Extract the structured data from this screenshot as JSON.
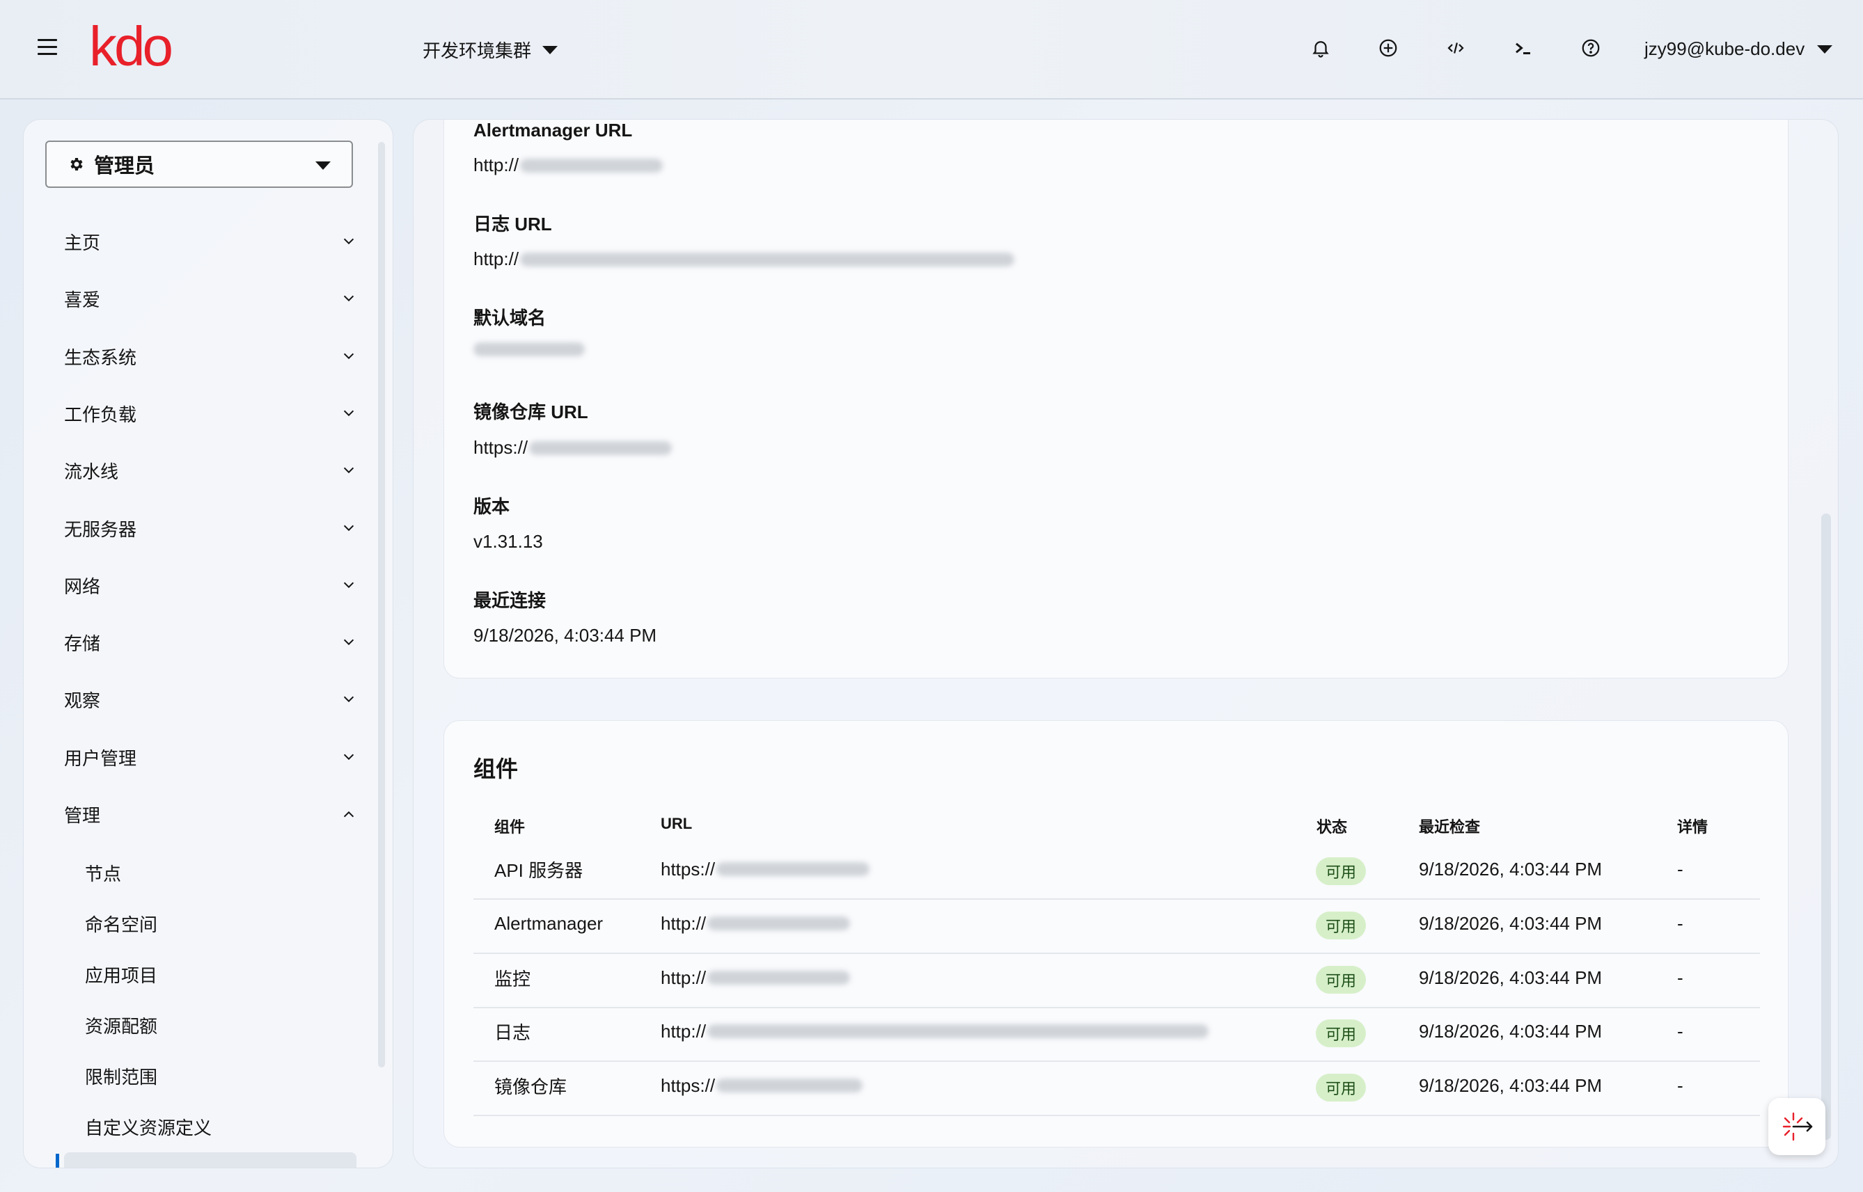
{
  "header": {
    "logo": "kdo",
    "cluster": "开发环境集群",
    "user": "jzy99@kube-do.dev"
  },
  "sidebar": {
    "role": "管理员",
    "items": [
      {
        "label": "主页",
        "expanded": false
      },
      {
        "label": "喜爱",
        "expanded": false
      },
      {
        "label": "生态系统",
        "expanded": false
      },
      {
        "label": "工作负载",
        "expanded": false
      },
      {
        "label": "流水线",
        "expanded": false
      },
      {
        "label": "无服务器",
        "expanded": false
      },
      {
        "label": "网络",
        "expanded": false
      },
      {
        "label": "存储",
        "expanded": false
      },
      {
        "label": "观察",
        "expanded": false
      },
      {
        "label": "用户管理",
        "expanded": false
      },
      {
        "label": "管理",
        "expanded": true
      }
    ],
    "sub_items": [
      "节点",
      "命名空间",
      "应用项目",
      "资源配额",
      "限制范围",
      "自定义资源定义"
    ]
  },
  "details": {
    "alertmanager_url": {
      "label": "Alertmanager URL",
      "value": "http://"
    },
    "logging_url": {
      "label": "日志 URL",
      "value": "http://"
    },
    "default_domain": {
      "label": "默认域名",
      "value": ""
    },
    "registry_url": {
      "label": "镜像仓库 URL",
      "value": "https://"
    },
    "version": {
      "label": "版本",
      "value": "v1.31.13"
    },
    "last_connected": {
      "label": "最近连接",
      "value": "9/18/2026, 4:03:44 PM"
    }
  },
  "components": {
    "title": "组件",
    "columns": [
      "组件",
      "URL",
      "状态",
      "最近检查",
      "详情"
    ],
    "rows": [
      {
        "name": "API 服务器",
        "url": "https://",
        "status": "可用",
        "checked": "9/18/2026, 4:03:44 PM",
        "detail": "-"
      },
      {
        "name": "Alertmanager",
        "url": "http://",
        "status": "可用",
        "checked": "9/18/2026, 4:03:44 PM",
        "detail": "-"
      },
      {
        "name": "监控",
        "url": "http://",
        "status": "可用",
        "checked": "9/18/2026, 4:03:44 PM",
        "detail": "-"
      },
      {
        "name": "日志",
        "url": "http://",
        "status": "可用",
        "checked": "9/18/2026, 4:03:44 PM",
        "detail": "-"
      },
      {
        "name": "镜像仓库",
        "url": "https://",
        "status": "可用",
        "checked": "9/18/2026, 4:03:44 PM",
        "detail": "-"
      }
    ]
  },
  "colors": {
    "brand": "#e8202a",
    "available_badge": "#d6efc9",
    "active_indicator": "#0066cc"
  }
}
